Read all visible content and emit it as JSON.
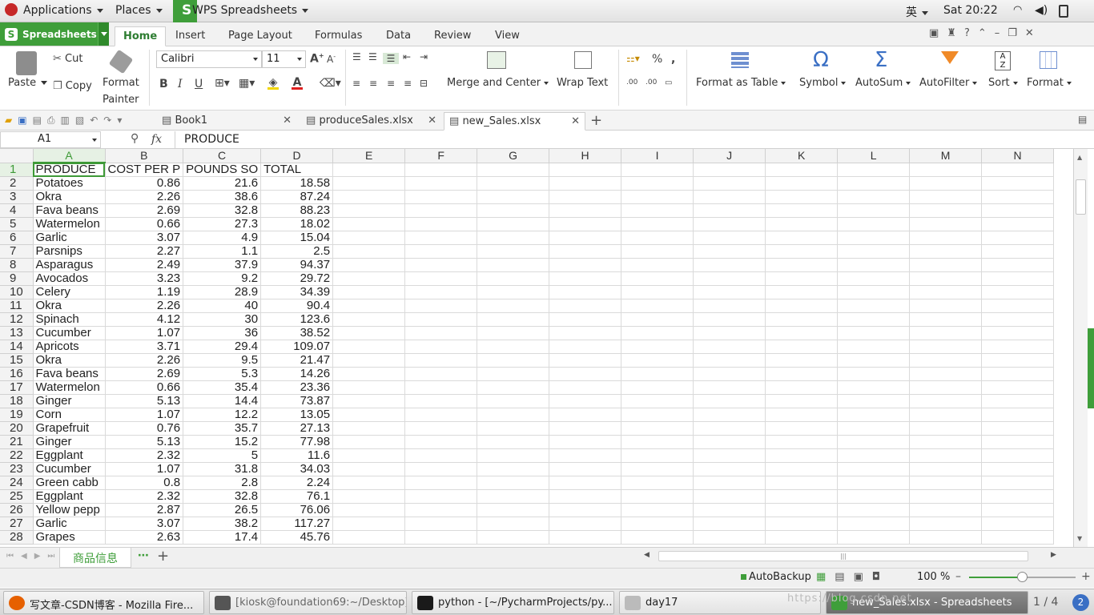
{
  "topbar": {
    "applications": "Applications",
    "places": "Places",
    "app_name": "WPS Spreadsheets",
    "ime": "英",
    "clock": "Sat 20:22"
  },
  "ribbon_tabs": {
    "app_button": "Spreadsheets",
    "tabs": [
      "Home",
      "Insert",
      "Page Layout",
      "Formulas",
      "Data",
      "Review",
      "View"
    ],
    "active": "Home"
  },
  "ribbon": {
    "paste": "Paste",
    "cut": "Cut",
    "copy": "Copy",
    "format_painter_1": "Format",
    "format_painter_2": "Painter",
    "font_name": "Calibri",
    "font_size": "11",
    "merge_center": "Merge and Center",
    "wrap_text": "Wrap Text",
    "percent": "%",
    "format_as_table": "Format as Table",
    "symbol": "Symbol",
    "autosum": "AutoSum",
    "autofilter": "AutoFilter",
    "sort": "Sort",
    "format": "Format"
  },
  "doc_tabs": [
    "Book1",
    "produceSales.xlsx",
    "new_Sales.xlsx"
  ],
  "formula_bar": {
    "cell_ref": "A1",
    "fx": "fx",
    "content": "PRODUCE"
  },
  "columns": [
    "A",
    "B",
    "C",
    "D",
    "E",
    "F",
    "G",
    "H",
    "I",
    "J",
    "K",
    "L",
    "M",
    "N"
  ],
  "rows": [
    [
      "PRODUCE",
      "COST PER P",
      "POUNDS SO",
      "TOTAL"
    ],
    [
      "Potatoes",
      "0.86",
      "21.6",
      "18.58"
    ],
    [
      "Okra",
      "2.26",
      "38.6",
      "87.24"
    ],
    [
      "Fava beans",
      "2.69",
      "32.8",
      "88.23"
    ],
    [
      "Watermelon",
      "0.66",
      "27.3",
      "18.02"
    ],
    [
      "Garlic",
      "3.07",
      "4.9",
      "15.04"
    ],
    [
      "Parsnips",
      "2.27",
      "1.1",
      "2.5"
    ],
    [
      "Asparagus",
      "2.49",
      "37.9",
      "94.37"
    ],
    [
      "Avocados",
      "3.23",
      "9.2",
      "29.72"
    ],
    [
      "Celery",
      "1.19",
      "28.9",
      "34.39"
    ],
    [
      "Okra",
      "2.26",
      "40",
      "90.4"
    ],
    [
      "Spinach",
      "4.12",
      "30",
      "123.6"
    ],
    [
      "Cucumber",
      "1.07",
      "36",
      "38.52"
    ],
    [
      "Apricots",
      "3.71",
      "29.4",
      "109.07"
    ],
    [
      "Okra",
      "2.26",
      "9.5",
      "21.47"
    ],
    [
      "Fava beans",
      "2.69",
      "5.3",
      "14.26"
    ],
    [
      "Watermelon",
      "0.66",
      "35.4",
      "23.36"
    ],
    [
      "Ginger",
      "5.13",
      "14.4",
      "73.87"
    ],
    [
      "Corn",
      "1.07",
      "12.2",
      "13.05"
    ],
    [
      "Grapefruit",
      "0.76",
      "35.7",
      "27.13"
    ],
    [
      "Ginger",
      "5.13",
      "15.2",
      "77.98"
    ],
    [
      "Eggplant",
      "2.32",
      "5",
      "11.6"
    ],
    [
      "Cucumber",
      "1.07",
      "31.8",
      "34.03"
    ],
    [
      "Green cabb",
      "0.8",
      "2.8",
      "2.24"
    ],
    [
      "Eggplant",
      "2.32",
      "32.8",
      "76.1"
    ],
    [
      "Yellow pepp",
      "2.87",
      "26.5",
      "76.06"
    ],
    [
      "Garlic",
      "3.07",
      "38.2",
      "117.27"
    ],
    [
      "Grapes",
      "2.63",
      "17.4",
      "45.76"
    ]
  ],
  "sheet_tab": "商品信息",
  "status": {
    "autobackup": "AutoBackup",
    "zoom": "100 %"
  },
  "taskbar": [
    {
      "label": "写文章-CSDN博客 - Mozilla Fire...",
      "color": "#e66000"
    },
    {
      "label": "[kiosk@foundation69:~/Desktop]",
      "color": "#555555"
    },
    {
      "label": "python - [~/PycharmProjects/py...",
      "color": "#1a1a1a"
    },
    {
      "label": "day17",
      "color": "#888888"
    },
    {
      "label": "new_Sales.xlsx - Spreadsheets",
      "color": "#3f9e3a"
    }
  ],
  "workspace": "1 / 4",
  "watermark": "https://blog.csdn.net",
  "colors": {
    "accent": "#3f9e3a",
    "grid_line": "#dadada"
  }
}
